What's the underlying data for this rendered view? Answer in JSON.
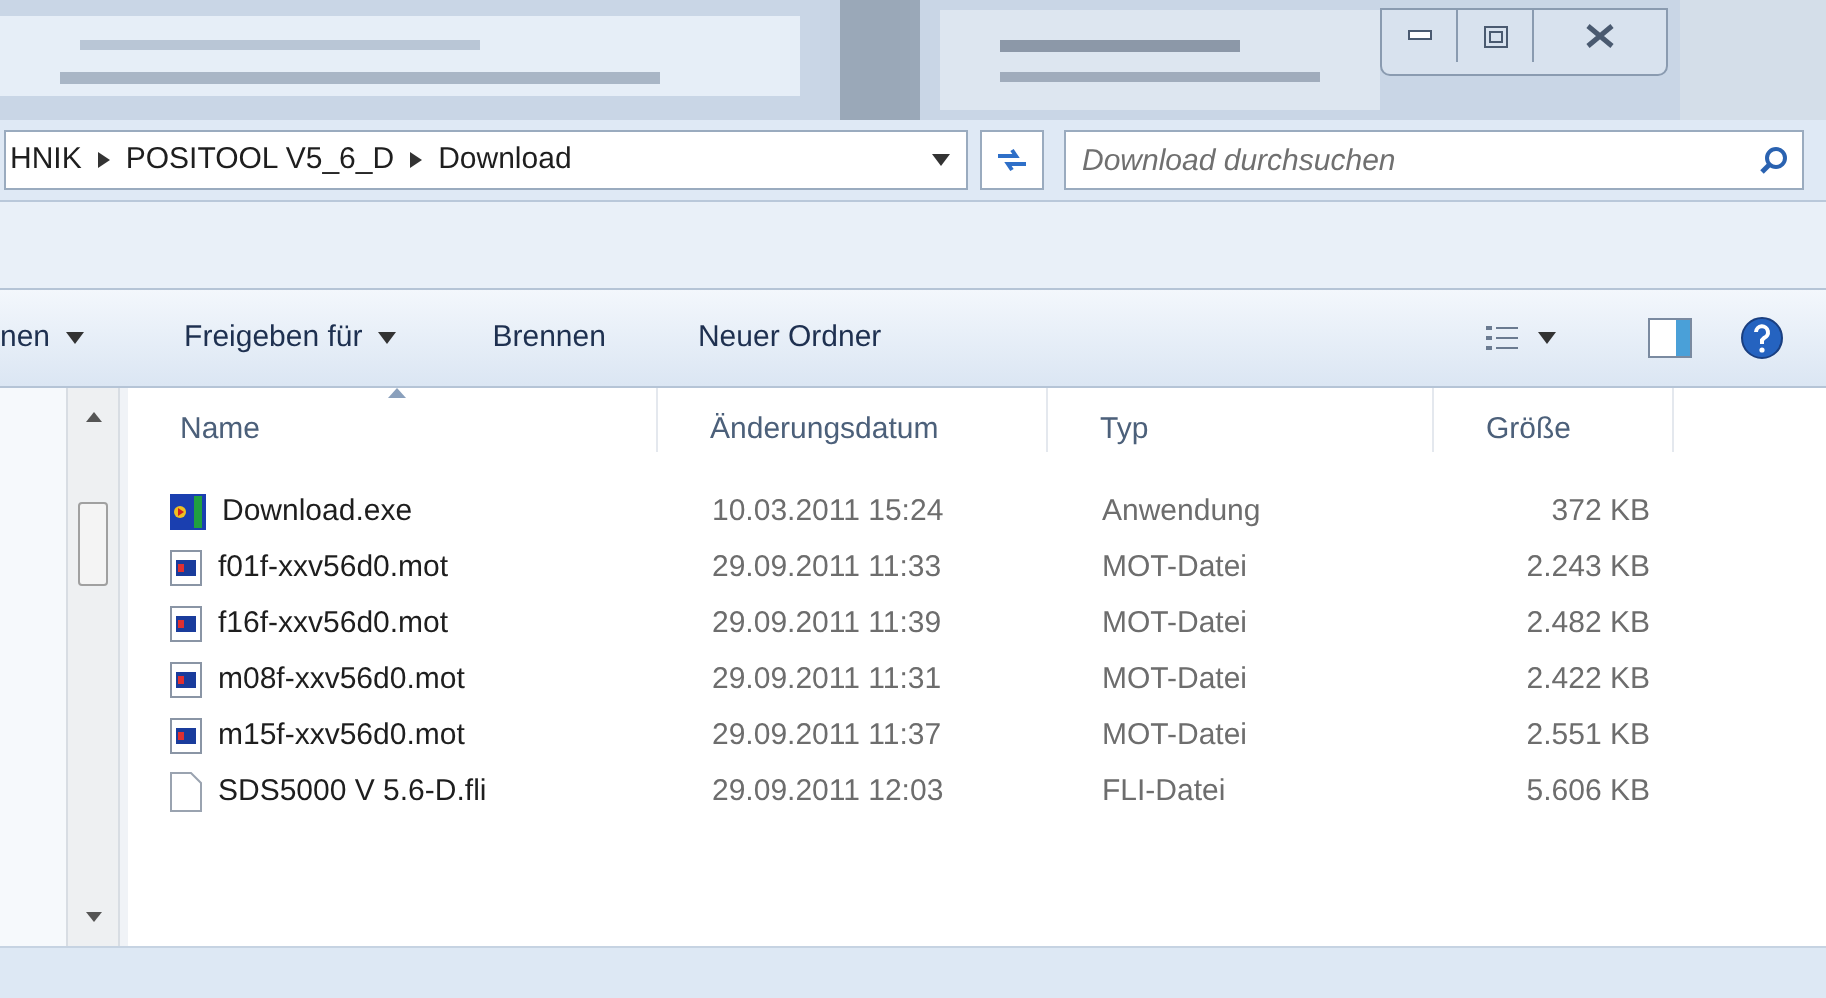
{
  "address_bar": {
    "segments": [
      "HNIK",
      "POSITOOL V5_6_D",
      "Download"
    ]
  },
  "search": {
    "placeholder": "Download durchsuchen"
  },
  "toolbar": {
    "items": [
      {
        "label": "nen",
        "dropdown": true
      },
      {
        "label": "Freigeben für",
        "dropdown": true
      },
      {
        "label": "Brennen",
        "dropdown": false
      },
      {
        "label": "Neuer Ordner",
        "dropdown": false
      }
    ]
  },
  "table": {
    "columns": [
      {
        "label": "Name",
        "sorted": true
      },
      {
        "label": "Änderungsdatum",
        "sorted": false
      },
      {
        "label": "Typ",
        "sorted": false
      },
      {
        "label": "Größe",
        "sorted": false
      }
    ],
    "rows": [
      {
        "kind": "exe",
        "name": "Download.exe",
        "date": "10.03.2011 15:24",
        "type": "Anwendung",
        "size": "372 KB"
      },
      {
        "kind": "mot",
        "name": "f01f-xxv56d0.mot",
        "date": "29.09.2011 11:33",
        "type": "MOT-Datei",
        "size": "2.243 KB"
      },
      {
        "kind": "mot",
        "name": "f16f-xxv56d0.mot",
        "date": "29.09.2011 11:39",
        "type": "MOT-Datei",
        "size": "2.482 KB"
      },
      {
        "kind": "mot",
        "name": "m08f-xxv56d0.mot",
        "date": "29.09.2011 11:31",
        "type": "MOT-Datei",
        "size": "2.422 KB"
      },
      {
        "kind": "mot",
        "name": "m15f-xxv56d0.mot",
        "date": "29.09.2011 11:37",
        "type": "MOT-Datei",
        "size": "2.551 KB"
      },
      {
        "kind": "file",
        "name": "SDS5000 V 5.6-D.fli",
        "date": "29.09.2011 12:03",
        "type": "FLI-Datei",
        "size": "5.606 KB"
      }
    ]
  }
}
